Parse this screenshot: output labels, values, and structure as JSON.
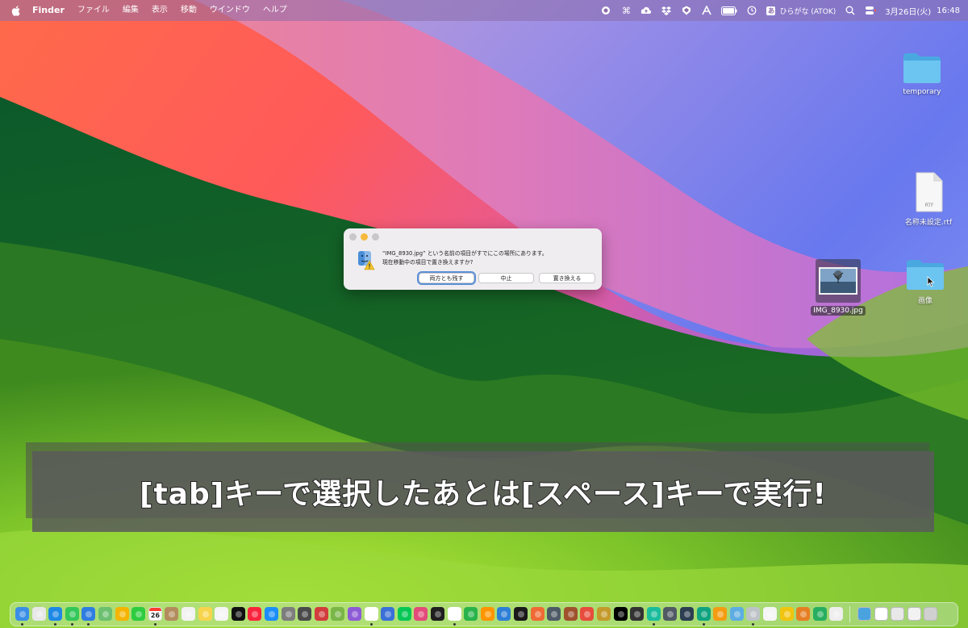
{
  "menubar": {
    "app_name": "Finder",
    "menus": [
      "ファイル",
      "編集",
      "表示",
      "移動",
      "ウインドウ",
      "ヘルプ"
    ],
    "status_icons": [
      "record-icon",
      "command-icon",
      "cloud-upload-icon",
      "dropbox-icon",
      "shield-icon",
      "font-icon",
      "battery-icon",
      "time-machine-icon"
    ],
    "input_method_label": "あ",
    "input_method": "ひらがな (ATOK)",
    "date": "3月26日(火)",
    "time": "16:48"
  },
  "desktop": {
    "icons": [
      {
        "label": "temporary",
        "kind": "folder-icon"
      },
      {
        "label": "名称未設定.rtf",
        "kind": "rtf-document-icon",
        "badge": "RTF"
      },
      {
        "label": "画像",
        "kind": "folder-icon"
      },
      {
        "label": "IMG_8930.jpg",
        "kind": "image-file-icon"
      }
    ]
  },
  "dialog": {
    "message_line1": "“IMG_8930.jpg” という名前の項目がすでにこの場所にあります。",
    "message_line2": "現在移動中の項目で置き換えますか?",
    "buttons": {
      "keep_both": "両方とも残す",
      "stop": "中止",
      "replace": "置き換える"
    }
  },
  "caption": {
    "text": "[tab]キーで選択したあとは[スペース]キーで実行!"
  },
  "dock": {
    "calendar_day": "26",
    "apps": [
      {
        "name": "finder-icon",
        "color": "#3a8ee6"
      },
      {
        "name": "launchpad-icon",
        "color": "#e8e8e8"
      },
      {
        "name": "safari-icon",
        "color": "#1e88e5"
      },
      {
        "name": "messages-icon",
        "color": "#34c759"
      },
      {
        "name": "mail-icon",
        "color": "#2f7de1"
      },
      {
        "name": "maps-icon",
        "color": "#6cc070"
      },
      {
        "name": "photos-icon",
        "color": "#f4b400"
      },
      {
        "name": "facetime-icon",
        "color": "#2ecc40"
      },
      {
        "name": "calendar-icon",
        "color": "#ffffff"
      },
      {
        "name": "notes-app-icon",
        "color": "#b38b5d"
      },
      {
        "name": "reminders-icon",
        "color": "#f2f2f2"
      },
      {
        "name": "notes-icon",
        "color": "#f7d44c"
      },
      {
        "name": "freeform-icon",
        "color": "#f5f5f5"
      },
      {
        "name": "apple-tv-icon",
        "color": "#111111"
      },
      {
        "name": "music-icon",
        "color": "#fa243c"
      },
      {
        "name": "app-store-icon",
        "color": "#1c8ef9"
      },
      {
        "name": "settings-icon",
        "color": "#7d7d7d"
      },
      {
        "name": "image-tool-icon",
        "color": "#4a4a4a"
      },
      {
        "name": "app-red-icon",
        "color": "#d23c3c"
      },
      {
        "name": "app-green-icon",
        "color": "#7ab648"
      },
      {
        "name": "app-purple-icon",
        "color": "#8e5bd6"
      },
      {
        "name": "chrome-icon",
        "color": "#ffffff"
      },
      {
        "name": "app-blue-icon",
        "color": "#3a70d8"
      },
      {
        "name": "line-icon",
        "color": "#06c755"
      },
      {
        "name": "app-pink-icon",
        "color": "#e24b7a"
      },
      {
        "name": "chatgpt-icon",
        "color": "#1f1f1f"
      },
      {
        "name": "google-maps-icon",
        "color": "#ffffff"
      },
      {
        "name": "numbers-icon",
        "color": "#29b34a"
      },
      {
        "name": "pages-icon",
        "color": "#ff9500"
      },
      {
        "name": "keynote-icon",
        "color": "#2d7fd6"
      },
      {
        "name": "final-cut-icon",
        "color": "#1a1a1a"
      },
      {
        "name": "app-orange-icon",
        "color": "#f06a35"
      },
      {
        "name": "app-gray-icon",
        "color": "#4e5a66"
      },
      {
        "name": "app-brown-icon",
        "color": "#a0522d"
      },
      {
        "name": "office-icon",
        "color": "#e74c3c"
      },
      {
        "name": "app-gold-icon",
        "color": "#c49a2c"
      },
      {
        "name": "xd-icon",
        "color": "#000000"
      },
      {
        "name": "app-dark-icon",
        "color": "#333333"
      },
      {
        "name": "app-teal-icon",
        "color": "#1abc9c"
      },
      {
        "name": "app-slate-icon",
        "color": "#505a64"
      },
      {
        "name": "app-navy-icon",
        "color": "#2c3e50"
      },
      {
        "name": "chatgpt-green-icon",
        "color": "#10a37f"
      },
      {
        "name": "app-amber-icon",
        "color": "#f39c12"
      },
      {
        "name": "app-cyan-icon",
        "color": "#5dade2"
      },
      {
        "name": "app-silver-icon",
        "color": "#bdc3c7"
      },
      {
        "name": "textedit-icon",
        "color": "#f5f5f5"
      },
      {
        "name": "app-yellow-icon",
        "color": "#f1c40f"
      },
      {
        "name": "app-rose-icon",
        "color": "#e67e22"
      },
      {
        "name": "app-lime-icon",
        "color": "#27ae60"
      },
      {
        "name": "panda-icon",
        "color": "#eeeeee"
      }
    ],
    "right_items": [
      {
        "name": "downloads-stack-icon",
        "color": "#4aa3df"
      },
      {
        "name": "stack-white-icon",
        "color": "#ffffff"
      },
      {
        "name": "stack-doc-icon",
        "color": "#e8e8e8"
      },
      {
        "name": "stack-doc2-icon",
        "color": "#f2f2f2"
      },
      {
        "name": "trash-icon",
        "color": "#d0d0d0"
      }
    ]
  }
}
